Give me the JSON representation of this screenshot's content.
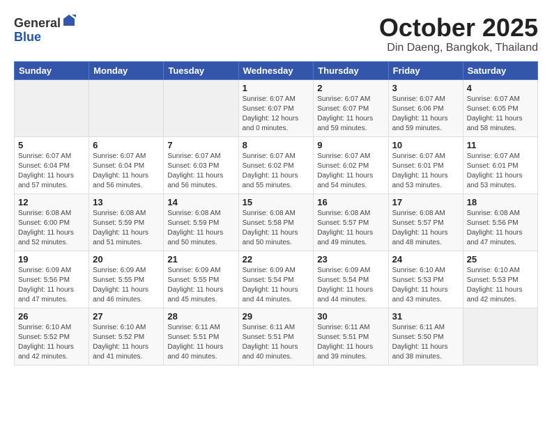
{
  "header": {
    "logo_general": "General",
    "logo_blue": "Blue",
    "month_title": "October 2025",
    "location": "Din Daeng, Bangkok, Thailand"
  },
  "weekdays": [
    "Sunday",
    "Monday",
    "Tuesday",
    "Wednesday",
    "Thursday",
    "Friday",
    "Saturday"
  ],
  "weeks": [
    [
      {
        "day": "",
        "info": ""
      },
      {
        "day": "",
        "info": ""
      },
      {
        "day": "",
        "info": ""
      },
      {
        "day": "1",
        "info": "Sunrise: 6:07 AM\nSunset: 6:07 PM\nDaylight: 12 hours\nand 0 minutes."
      },
      {
        "day": "2",
        "info": "Sunrise: 6:07 AM\nSunset: 6:07 PM\nDaylight: 11 hours\nand 59 minutes."
      },
      {
        "day": "3",
        "info": "Sunrise: 6:07 AM\nSunset: 6:06 PM\nDaylight: 11 hours\nand 59 minutes."
      },
      {
        "day": "4",
        "info": "Sunrise: 6:07 AM\nSunset: 6:05 PM\nDaylight: 11 hours\nand 58 minutes."
      }
    ],
    [
      {
        "day": "5",
        "info": "Sunrise: 6:07 AM\nSunset: 6:04 PM\nDaylight: 11 hours\nand 57 minutes."
      },
      {
        "day": "6",
        "info": "Sunrise: 6:07 AM\nSunset: 6:04 PM\nDaylight: 11 hours\nand 56 minutes."
      },
      {
        "day": "7",
        "info": "Sunrise: 6:07 AM\nSunset: 6:03 PM\nDaylight: 11 hours\nand 56 minutes."
      },
      {
        "day": "8",
        "info": "Sunrise: 6:07 AM\nSunset: 6:02 PM\nDaylight: 11 hours\nand 55 minutes."
      },
      {
        "day": "9",
        "info": "Sunrise: 6:07 AM\nSunset: 6:02 PM\nDaylight: 11 hours\nand 54 minutes."
      },
      {
        "day": "10",
        "info": "Sunrise: 6:07 AM\nSunset: 6:01 PM\nDaylight: 11 hours\nand 53 minutes."
      },
      {
        "day": "11",
        "info": "Sunrise: 6:07 AM\nSunset: 6:01 PM\nDaylight: 11 hours\nand 53 minutes."
      }
    ],
    [
      {
        "day": "12",
        "info": "Sunrise: 6:08 AM\nSunset: 6:00 PM\nDaylight: 11 hours\nand 52 minutes."
      },
      {
        "day": "13",
        "info": "Sunrise: 6:08 AM\nSunset: 5:59 PM\nDaylight: 11 hours\nand 51 minutes."
      },
      {
        "day": "14",
        "info": "Sunrise: 6:08 AM\nSunset: 5:59 PM\nDaylight: 11 hours\nand 50 minutes."
      },
      {
        "day": "15",
        "info": "Sunrise: 6:08 AM\nSunset: 5:58 PM\nDaylight: 11 hours\nand 50 minutes."
      },
      {
        "day": "16",
        "info": "Sunrise: 6:08 AM\nSunset: 5:57 PM\nDaylight: 11 hours\nand 49 minutes."
      },
      {
        "day": "17",
        "info": "Sunrise: 6:08 AM\nSunset: 5:57 PM\nDaylight: 11 hours\nand 48 minutes."
      },
      {
        "day": "18",
        "info": "Sunrise: 6:08 AM\nSunset: 5:56 PM\nDaylight: 11 hours\nand 47 minutes."
      }
    ],
    [
      {
        "day": "19",
        "info": "Sunrise: 6:09 AM\nSunset: 5:56 PM\nDaylight: 11 hours\nand 47 minutes."
      },
      {
        "day": "20",
        "info": "Sunrise: 6:09 AM\nSunset: 5:55 PM\nDaylight: 11 hours\nand 46 minutes."
      },
      {
        "day": "21",
        "info": "Sunrise: 6:09 AM\nSunset: 5:55 PM\nDaylight: 11 hours\nand 45 minutes."
      },
      {
        "day": "22",
        "info": "Sunrise: 6:09 AM\nSunset: 5:54 PM\nDaylight: 11 hours\nand 44 minutes."
      },
      {
        "day": "23",
        "info": "Sunrise: 6:09 AM\nSunset: 5:54 PM\nDaylight: 11 hours\nand 44 minutes."
      },
      {
        "day": "24",
        "info": "Sunrise: 6:10 AM\nSunset: 5:53 PM\nDaylight: 11 hours\nand 43 minutes."
      },
      {
        "day": "25",
        "info": "Sunrise: 6:10 AM\nSunset: 5:53 PM\nDaylight: 11 hours\nand 42 minutes."
      }
    ],
    [
      {
        "day": "26",
        "info": "Sunrise: 6:10 AM\nSunset: 5:52 PM\nDaylight: 11 hours\nand 42 minutes."
      },
      {
        "day": "27",
        "info": "Sunrise: 6:10 AM\nSunset: 5:52 PM\nDaylight: 11 hours\nand 41 minutes."
      },
      {
        "day": "28",
        "info": "Sunrise: 6:11 AM\nSunset: 5:51 PM\nDaylight: 11 hours\nand 40 minutes."
      },
      {
        "day": "29",
        "info": "Sunrise: 6:11 AM\nSunset: 5:51 PM\nDaylight: 11 hours\nand 40 minutes."
      },
      {
        "day": "30",
        "info": "Sunrise: 6:11 AM\nSunset: 5:51 PM\nDaylight: 11 hours\nand 39 minutes."
      },
      {
        "day": "31",
        "info": "Sunrise: 6:11 AM\nSunset: 5:50 PM\nDaylight: 11 hours\nand 38 minutes."
      },
      {
        "day": "",
        "info": ""
      }
    ]
  ]
}
